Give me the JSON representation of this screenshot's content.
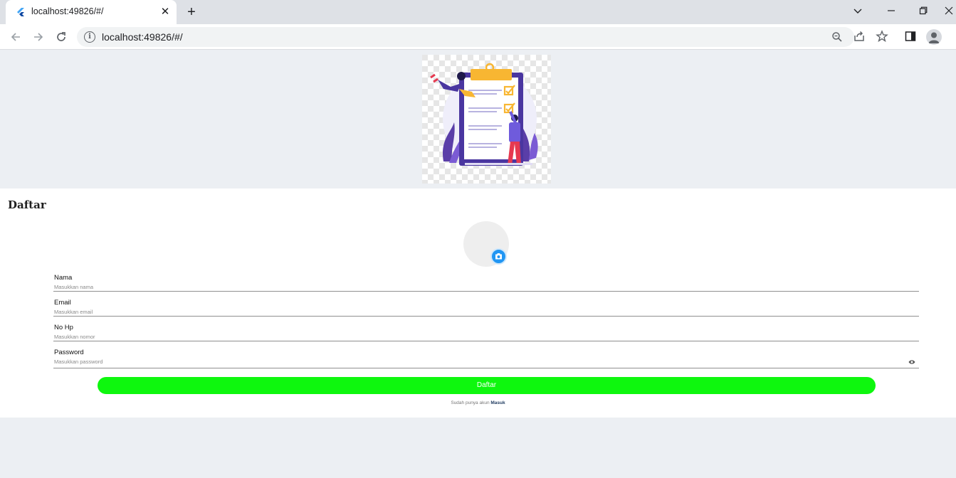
{
  "browser": {
    "tab_title": "localhost:49826/#/",
    "url": "localhost:49826/#/",
    "close_glyph": "✕",
    "new_tab_glyph": "+"
  },
  "page": {
    "title": "Daftar",
    "fields": [
      {
        "label": "Nama",
        "placeholder": "Masukkan nama"
      },
      {
        "label": "Email",
        "placeholder": "Masukkan email"
      },
      {
        "label": "No Hp",
        "placeholder": "Masukkan nomor"
      },
      {
        "label": "Password",
        "placeholder": "Masukkan password"
      }
    ],
    "submit_label": "Daftar",
    "login_prompt": "Sudah punya akun",
    "login_link": "Masuk"
  },
  "colors": {
    "accent": "#0ef70e",
    "camera": "#2196f3",
    "background": "#eceff3"
  },
  "icons": [
    "flutter-icon",
    "back-icon",
    "forward-icon",
    "reload-icon",
    "info-icon",
    "zoom-icon",
    "share-icon",
    "star-icon",
    "sidepanel-icon",
    "profile-icon",
    "camera-icon",
    "eye-icon"
  ]
}
